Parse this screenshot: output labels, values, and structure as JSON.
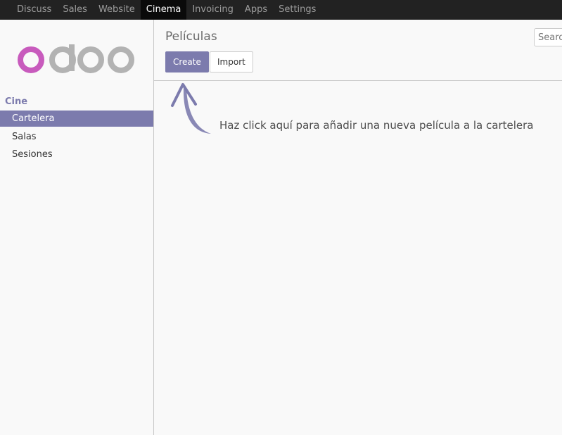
{
  "topbar": {
    "menu": [
      {
        "label": "Discuss",
        "active": false
      },
      {
        "label": "Sales",
        "active": false
      },
      {
        "label": "Website",
        "active": false
      },
      {
        "label": "Cinema",
        "active": true
      },
      {
        "label": "Invoicing",
        "active": false
      },
      {
        "label": "Apps",
        "active": false
      },
      {
        "label": "Settings",
        "active": false
      }
    ]
  },
  "sidebar": {
    "logo_text": "odoo",
    "section_title": "Cine",
    "items": [
      {
        "label": "Cartelera",
        "active": true
      },
      {
        "label": "Salas",
        "active": false
      },
      {
        "label": "Sesiones",
        "active": false
      }
    ]
  },
  "control_panel": {
    "title": "Películas",
    "create_label": "Create",
    "import_label": "Import",
    "search_placeholder": "Search"
  },
  "helper": {
    "text": "Haz click aquí para añadir una nueva película a la cartelera"
  },
  "colors": {
    "brand": "#7c7bad",
    "topbar": "#222222",
    "logo_o": "#c85bbd",
    "logo_doo": "#b3b3b3"
  }
}
